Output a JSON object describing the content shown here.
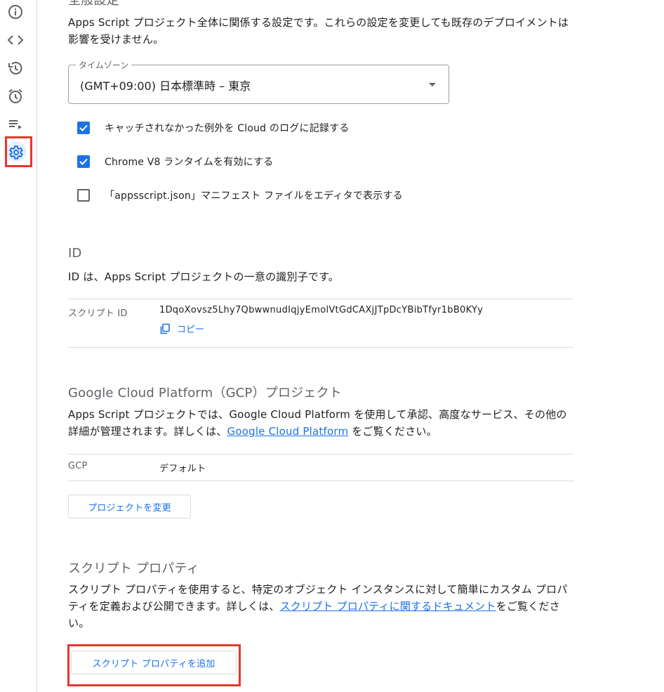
{
  "colors": {
    "accent": "#1a73e8",
    "highlight": "#e8362a",
    "muted": "#5f6368"
  },
  "sidebar": {
    "items": [
      {
        "name": "overview",
        "icon": "info-icon"
      },
      {
        "name": "editor",
        "icon": "code-icon"
      },
      {
        "name": "executions-history",
        "icon": "history-icon"
      },
      {
        "name": "triggers",
        "icon": "alarm-clock-icon"
      },
      {
        "name": "executions",
        "icon": "playlist-icon"
      },
      {
        "name": "project-settings",
        "icon": "gear-icon",
        "active": true
      }
    ]
  },
  "general": {
    "title": "全般設定",
    "description": "Apps Script プロジェクト全体に関係する設定です。これらの設定を変更しても既存のデプロイメントは影響を受けません。",
    "timezone": {
      "label": "タイムゾーン",
      "value": "(GMT+09:00) 日本標準時 – 東京"
    },
    "options": [
      {
        "label": "キャッチされなかった例外を Cloud のログに記録する",
        "checked": true
      },
      {
        "label": "Chrome V8 ランタイムを有効にする",
        "checked": true
      },
      {
        "label": "「appsscript.json」マニフェスト ファイルをエディタで表示する",
        "checked": false
      }
    ]
  },
  "ids": {
    "title": "ID",
    "description": "ID は、Apps Script プロジェクトの一意の識別子です。",
    "script_id_label": "スクリプト ID",
    "script_id_value": "1DqoXovsz5Lhy7QbwwnudIqjyEmolVtGdCAXjJTpDcYBibTfyr1bB0KYy",
    "copy_label": "コピー"
  },
  "gcp": {
    "title": "Google Cloud Platform（GCP）プロジェクト",
    "description_before": "Apps Script プロジェクトでは、Google Cloud Platform を使用して承認、高度なサービス、その他の詳細が管理されます。詳しくは、",
    "link_text": "Google Cloud Platform",
    "description_after": " をご覧ください。",
    "row_label": "GCP",
    "row_value": "デフォルト",
    "change_button": "プロジェクトを変更"
  },
  "script_properties": {
    "title": "スクリプト プロパティ",
    "description_before": "スクリプト プロパティを使用すると、特定のオブジェクト インスタンスに対して簡単にカスタム プロパティを定義および公開できます。詳しくは、",
    "link_text": "スクリプト プロパティに関するドキュメント",
    "description_after": "をご覧ください。",
    "add_button": "スクリプト プロパティを追加"
  }
}
